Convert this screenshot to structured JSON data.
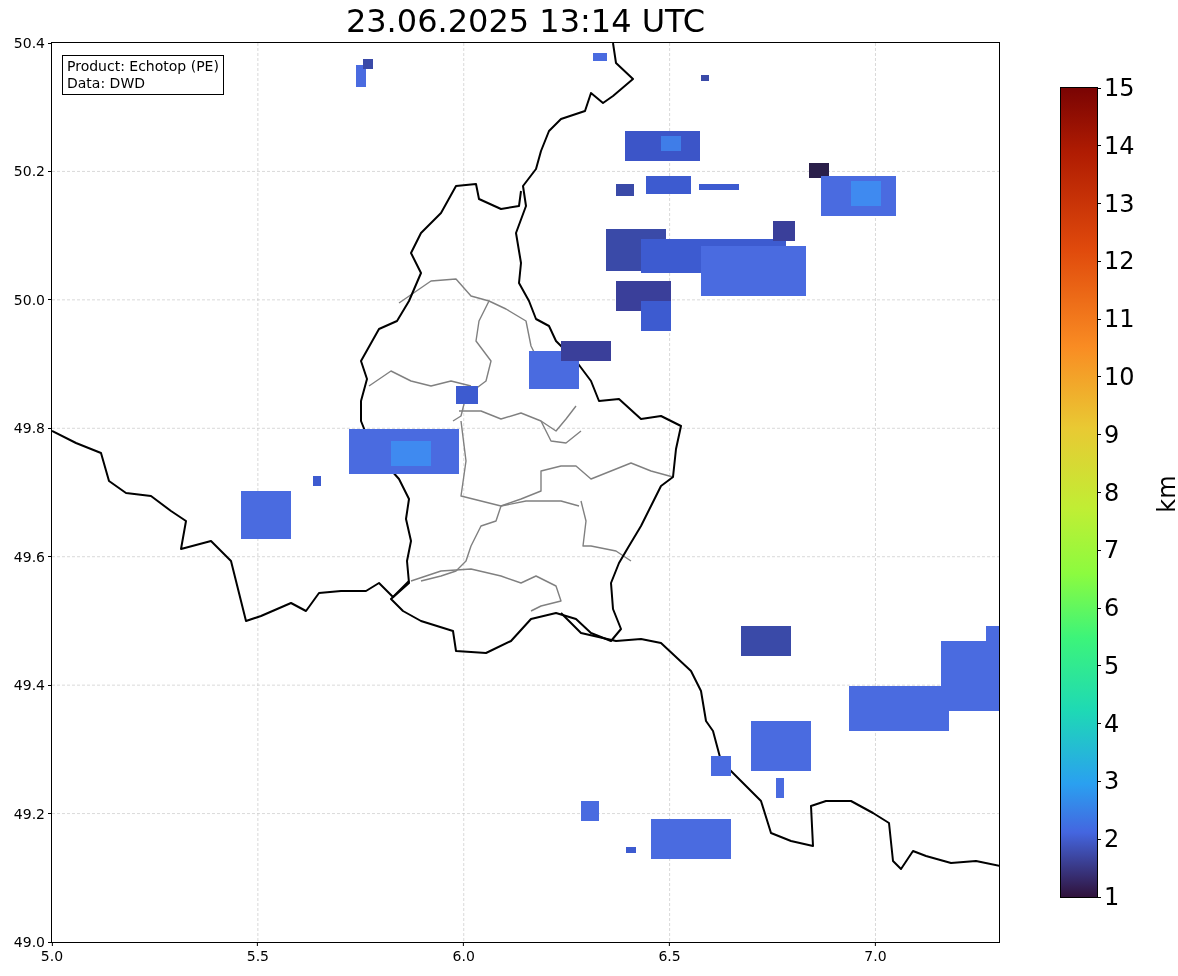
{
  "title": "23.06.2025 13:14 UTC",
  "info_box": {
    "lines": [
      "Product: Echotop (PE)",
      "Data: DWD"
    ]
  },
  "map": {
    "x_ticks": [
      "5.0",
      "5.5",
      "6.0",
      "6.5",
      "7.0"
    ],
    "y_ticks": [
      "50.4",
      "50.2",
      "50.0",
      "49.8",
      "49.6",
      "49.4",
      "49.2",
      "49.0"
    ]
  },
  "colorbar": {
    "label": "km",
    "ticks": [
      "15",
      "14",
      "13",
      "12",
      "11",
      "10",
      "9",
      "8",
      "7",
      "6",
      "5",
      "4",
      "3",
      "2",
      "1"
    ]
  }
}
